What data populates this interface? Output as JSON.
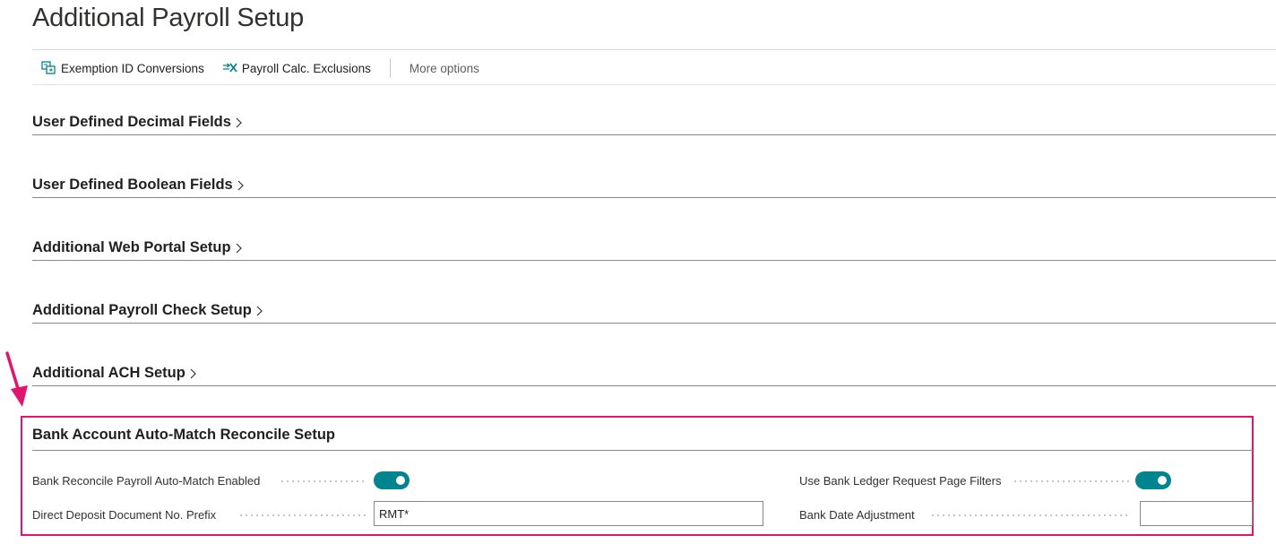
{
  "page": {
    "title": "Additional Payroll Setup"
  },
  "actions": {
    "exemption_label": "Exemption ID Conversions",
    "exclusions_label": "Payroll Calc. Exclusions",
    "more_label": "More options"
  },
  "sections": [
    {
      "title": "User Defined Decimal Fields"
    },
    {
      "title": "User Defined Boolean Fields"
    },
    {
      "title": "Additional Web Portal Setup"
    },
    {
      "title": "Additional Payroll Check Setup"
    },
    {
      "title": "Additional ACH Setup"
    }
  ],
  "bank_section": {
    "title": "Bank Account Auto-Match Reconcile Setup",
    "fields": {
      "auto_match_label": "Bank Reconcile Payroll Auto-Match Enabled",
      "auto_match_enabled": true,
      "prefix_label": "Direct Deposit Document No. Prefix",
      "prefix_value": "RMT*",
      "request_filters_label": "Use Bank Ledger Request Page Filters",
      "request_filters_enabled": true,
      "date_adjust_label": "Bank Date Adjustment",
      "date_adjust_value": ""
    }
  },
  "colors": {
    "accent": "#00848f",
    "highlight": "#e0166e",
    "icon_teal": "#00848f"
  },
  "icons": {
    "exemption": "conversion-icon",
    "exclusions": "exclusion-icon",
    "chevron": "chevron-right-icon",
    "arrow": "annotation-arrow-icon"
  }
}
